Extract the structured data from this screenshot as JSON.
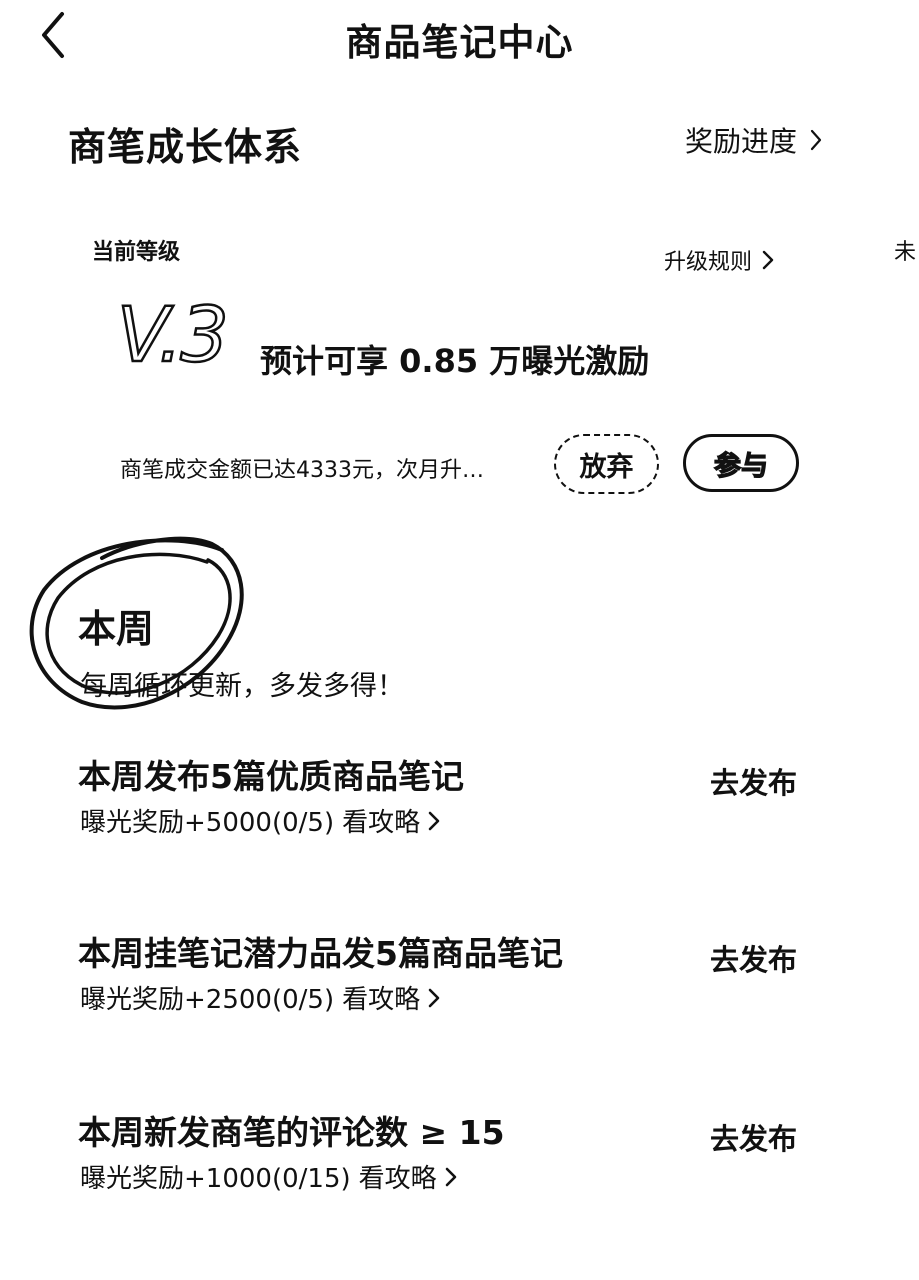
{
  "header": {
    "title": "商品笔记中心",
    "back_icon": "chevron-left-icon"
  },
  "growth": {
    "title": "商笔成长体系",
    "reward_link": "奖励进度",
    "current_level_label": "当前等级",
    "upgrade_rules_link": "升级规则",
    "edge_text": "未",
    "level": "V.3",
    "estimate": "预计可享 0.85 万曝光激励",
    "progress_msg": "商笔成交金额已达4333元，次月升…",
    "abandon_label": "放弃",
    "join_label": "参与"
  },
  "weekly": {
    "title": "本周",
    "subtitle": "每周循环更新，多发多得！",
    "tasks": [
      {
        "title": "本周发布5篇优质商品笔记",
        "reward": "曝光奖励+5000(0/5)",
        "guide": "看攻略",
        "action": "去发布"
      },
      {
        "title": "本周挂笔记潜力品发5篇商品笔记",
        "reward": "曝光奖励+2500(0/5)",
        "guide": "看攻略",
        "action": "去发布"
      },
      {
        "title": "本周新发商笔的评论数 ≥ 15",
        "reward": "曝光奖励+1000(0/15)",
        "guide": "看攻略",
        "action": "去发布"
      }
    ]
  }
}
